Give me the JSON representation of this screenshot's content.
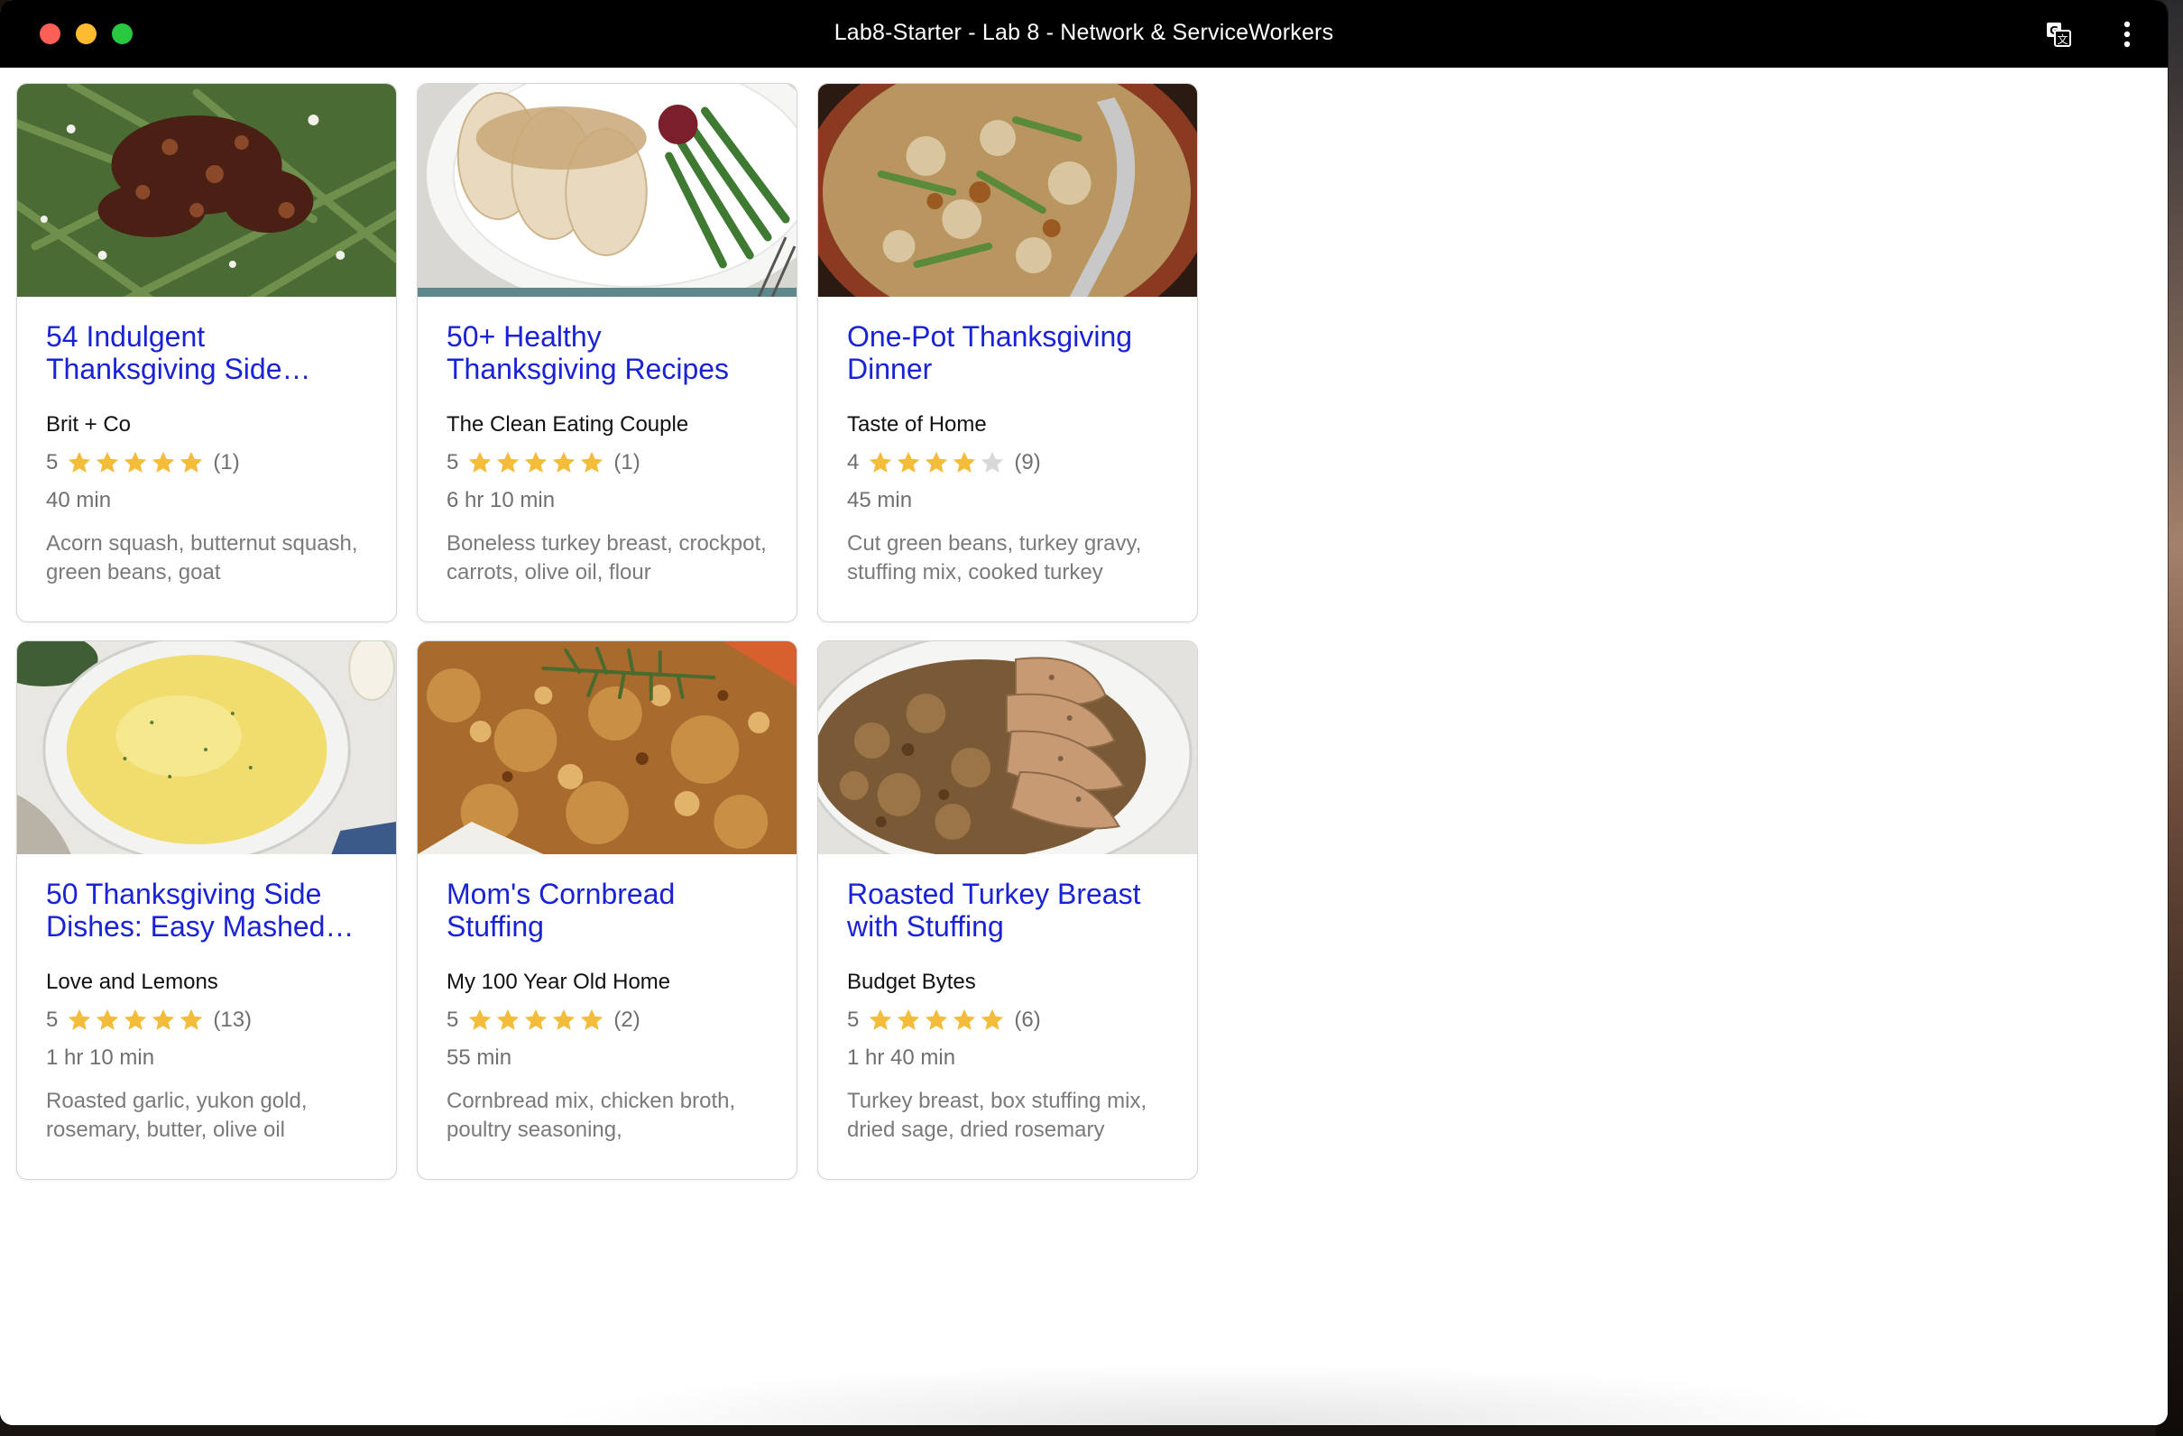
{
  "window": {
    "title": "Lab8-Starter - Lab 8 - Network & ServiceWorkers",
    "controls": [
      "close",
      "minimize",
      "maximize"
    ],
    "toolbar_icons": [
      "translate-icon",
      "more-options-icon"
    ]
  },
  "colors": {
    "title_link": "#1a22d6",
    "star_filled": "#f4bc3b",
    "star_empty": "#d9d9d9",
    "titlebar": "#000000"
  },
  "recipes": [
    {
      "title": "54 Indulgent Thanksgiving Side…",
      "source": "Brit + Co",
      "rating": "5",
      "stars": 5,
      "reviews": "(1)",
      "time": "40 min",
      "ingredients": "Acorn squash, butternut squash, green beans, goat",
      "image": "green beans with pecans"
    },
    {
      "title": "50+ Healthy Thanksgiving Recipes",
      "source": "The Clean Eating Couple",
      "rating": "5",
      "stars": 5,
      "reviews": "(1)",
      "time": "6 hr 10 min",
      "ingredients": "Boneless turkey breast, crockpot, carrots, olive oil, flour",
      "image": "sliced turkey with gravy and green beans"
    },
    {
      "title": "One-Pot Thanksgiving Dinner",
      "source": "Taste of Home",
      "rating": "4",
      "stars": 4,
      "reviews": "(9)",
      "time": "45 min",
      "ingredients": "Cut green beans, turkey gravy, stuffing mix, cooked turkey",
      "image": "turkey stuffing skillet"
    },
    {
      "title": "50 Thanksgiving Side Dishes: Easy Mashed…",
      "source": "Love and Lemons",
      "rating": "5",
      "stars": 5,
      "reviews": "(13)",
      "time": "1 hr 10 min",
      "ingredients": "Roasted garlic, yukon gold, rosemary, butter, olive oil",
      "image": "mashed potatoes"
    },
    {
      "title": "Mom's Cornbread Stuffing",
      "source": "My 100 Year Old Home",
      "rating": "5",
      "stars": 5,
      "reviews": "(2)",
      "time": "55 min",
      "ingredients": "Cornbread mix, chicken broth, poultry seasoning,",
      "image": "cornbread stuffing with rosemary"
    },
    {
      "title": "Roasted Turkey Breast with Stuffing",
      "source": "Budget Bytes",
      "rating": "5",
      "stars": 5,
      "reviews": "(6)",
      "time": "1 hr 40 min",
      "ingredients": "Turkey breast, box stuffing mix, dried sage, dried rosemary",
      "image": "sliced turkey breast on stuffing"
    }
  ]
}
